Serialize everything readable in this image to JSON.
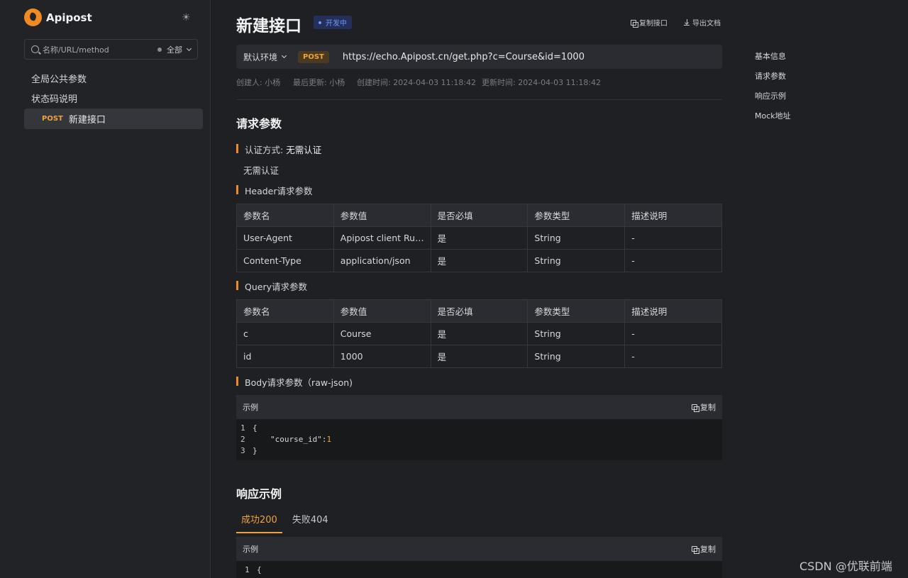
{
  "sidebar": {
    "brand": "Apipost",
    "theme_icon": "☀",
    "search_placeholder": "名称/URL/method",
    "filter_label": "全部",
    "items": [
      "全局公共参数",
      "状态码说明"
    ],
    "active_item": {
      "method": "POST",
      "label": "新建接口"
    }
  },
  "header": {
    "title": "新建接口",
    "status": "开发中",
    "copy_label": "复制接口",
    "export_label": "导出文档"
  },
  "urlbar": {
    "env": "默认环境",
    "method": "POST",
    "url": "https://echo.Apipost.cn/get.php?c=Course&id=1000"
  },
  "meta": {
    "creator": "创建人: 小杨",
    "updater": "最后更新: 小杨",
    "created": "创建时间: 2024-04-03 11:18:42",
    "updated": "更新时间: 2024-04-03 11:18:42"
  },
  "request": {
    "title": "请求参数",
    "auth_label": "认证方式: ",
    "auth_value": "无需认证",
    "auth_desc": "无需认证",
    "header_title": "Header请求参数",
    "query_title": "Query请求参数",
    "body_title": "Body请求参数（raw-json)",
    "columns": [
      "参数名",
      "参数值",
      "是否必填",
      "参数类型",
      "描述说明"
    ],
    "header_rows": [
      [
        "User-Agent",
        "Apipost client Runtime/+https://www.apipost.cn/",
        "是",
        "String",
        "-"
      ],
      [
        "Content-Type",
        "application/json",
        "是",
        "String",
        "-"
      ]
    ],
    "query_rows": [
      [
        "c",
        "Course",
        "是",
        "String",
        "-"
      ],
      [
        "id",
        "1000",
        "是",
        "String",
        "-"
      ]
    ],
    "body_card": {
      "label": "示例",
      "copy": "复制",
      "lines": [
        "1",
        "2",
        "3"
      ],
      "line1": "{",
      "key": "\"course_id\":",
      "val": "1",
      "line3": "}"
    }
  },
  "response": {
    "title": "响应示例",
    "tabs": [
      "成功200",
      "失败404"
    ],
    "card": {
      "label": "示例",
      "copy": "复制",
      "line_no": "1",
      "line1": "{"
    }
  },
  "toc": [
    "基本信息",
    "请求参数",
    "响应示例",
    "Mock地址"
  ],
  "watermark": "CSDN @优联前端",
  "colors": {
    "accent": "#f08a24",
    "status_blue": "#6e97ff",
    "background": "#1f2023"
  }
}
